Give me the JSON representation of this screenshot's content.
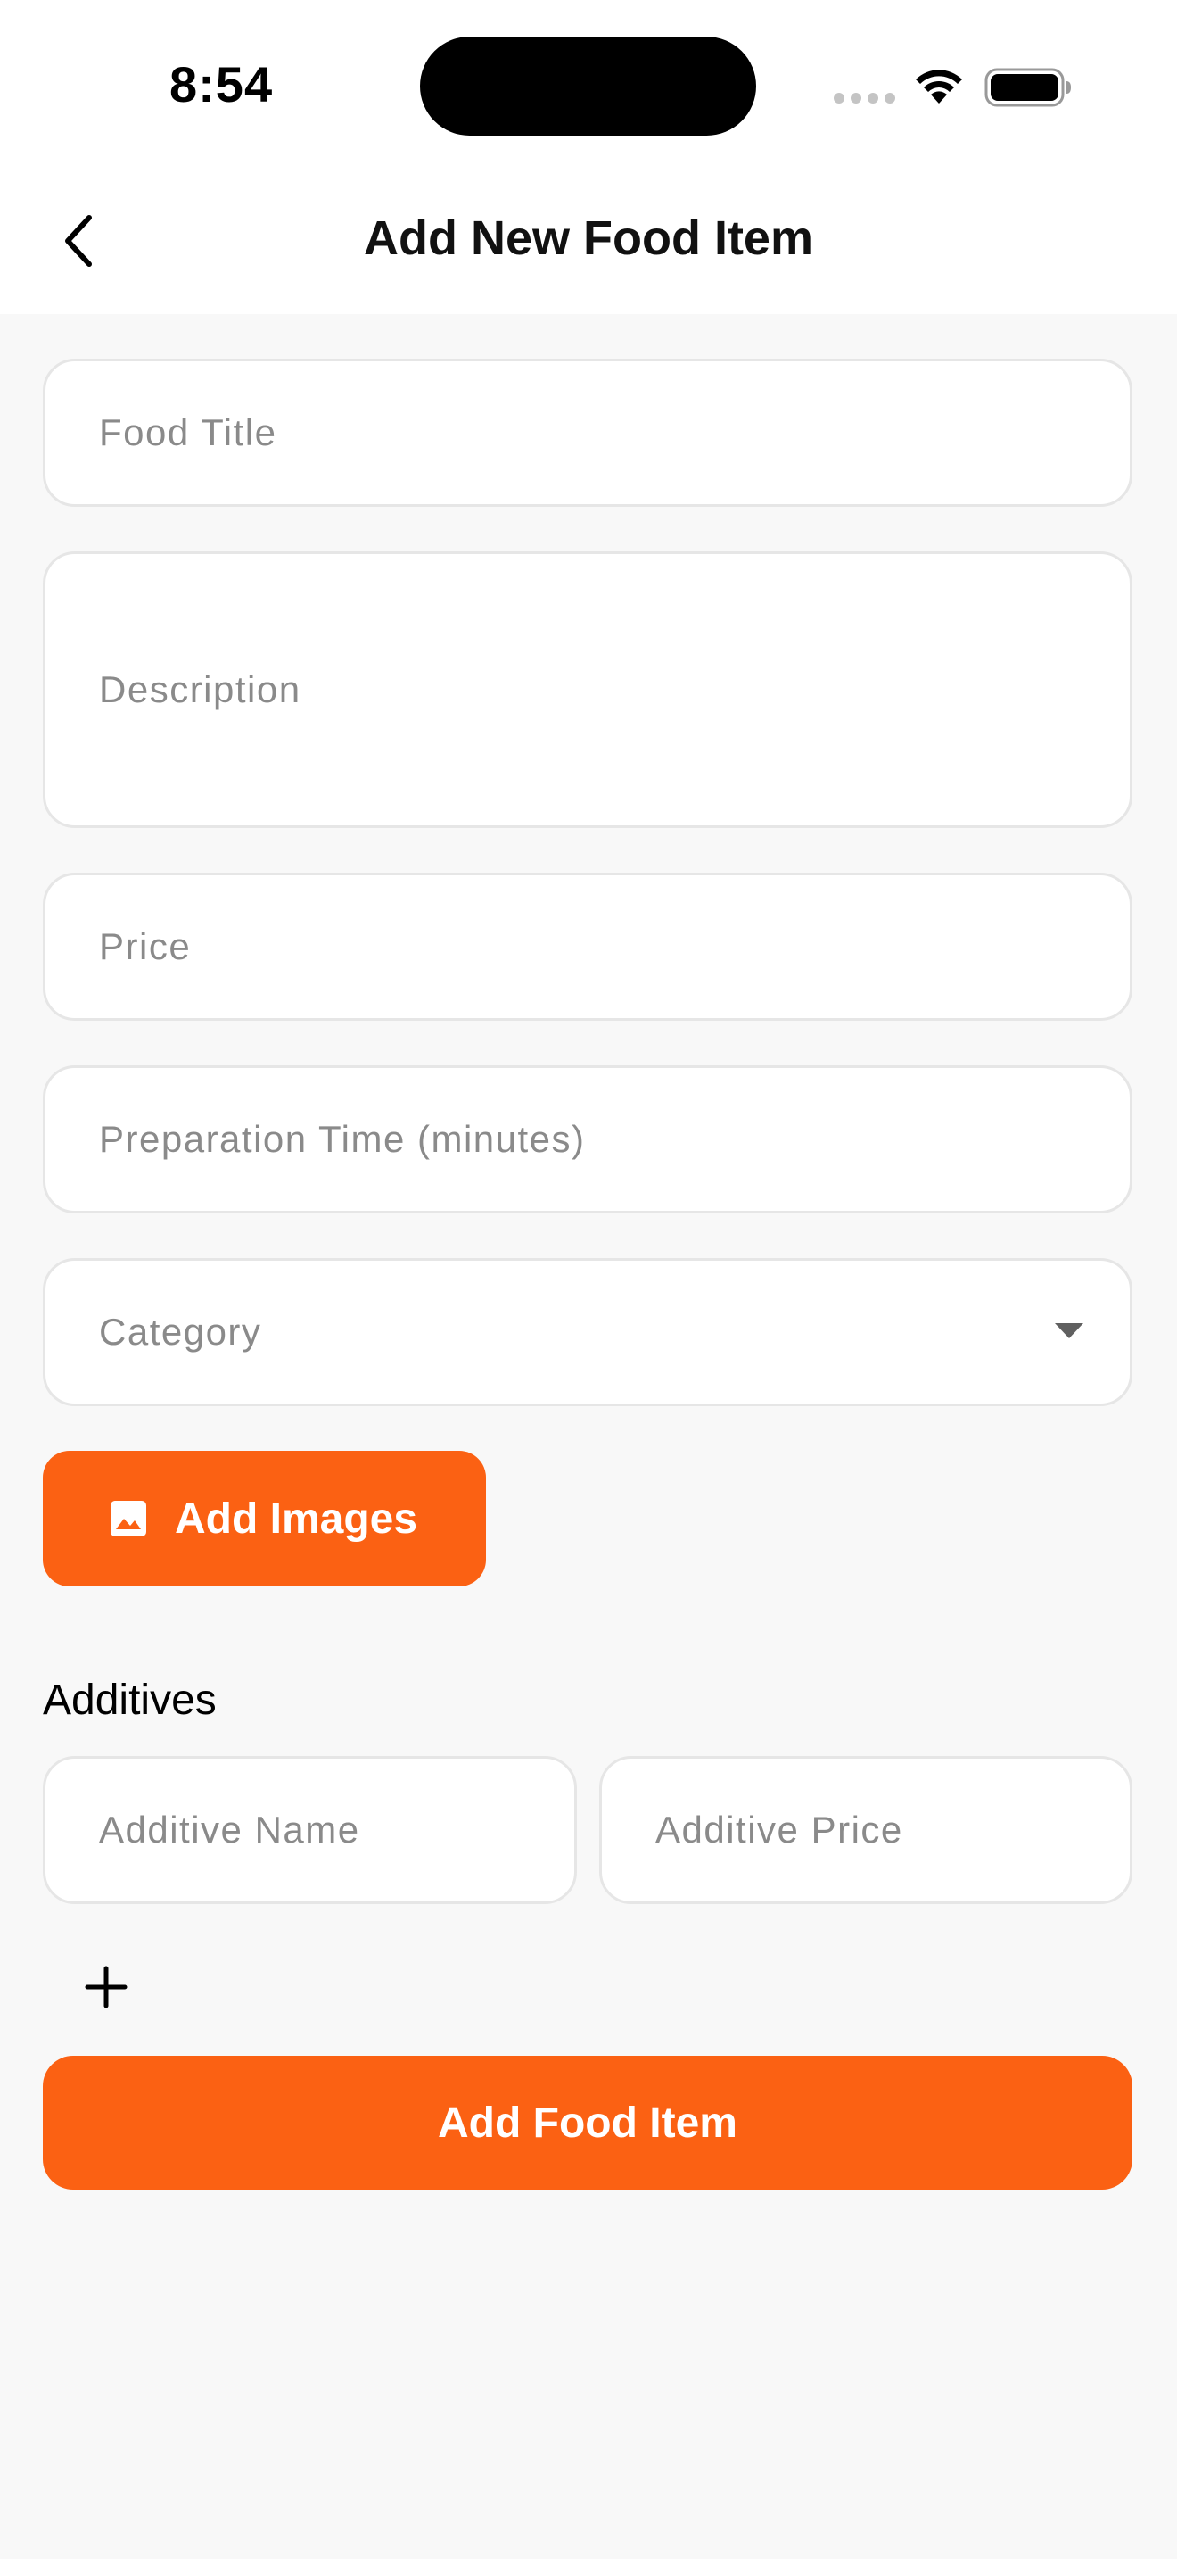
{
  "status_bar": {
    "time": "8:54"
  },
  "header": {
    "title": "Add New Food Item",
    "back_icon": "chevron-left-icon"
  },
  "form": {
    "food_title": {
      "placeholder": "Food Title",
      "value": ""
    },
    "description": {
      "placeholder": "Description",
      "value": ""
    },
    "price": {
      "placeholder": "Price",
      "value": ""
    },
    "preparation_time": {
      "placeholder": "Preparation Time (minutes)",
      "value": ""
    },
    "category": {
      "placeholder": "Category",
      "icon": "dropdown-arrow-icon"
    },
    "add_images": {
      "label": "Add Images",
      "icon": "image-icon"
    }
  },
  "additives": {
    "heading": "Additives",
    "name_field": {
      "placeholder": "Additive Name",
      "value": ""
    },
    "price_field": {
      "placeholder": "Additive Price",
      "value": ""
    },
    "add_icon": "plus-icon"
  },
  "submit": {
    "label": "Add Food Item"
  },
  "colors": {
    "accent": "#fb6113",
    "background": "#f8f8f8",
    "field_background": "#ffffff",
    "field_border": "#e6e6e6",
    "placeholder": "#8a8a8a"
  }
}
